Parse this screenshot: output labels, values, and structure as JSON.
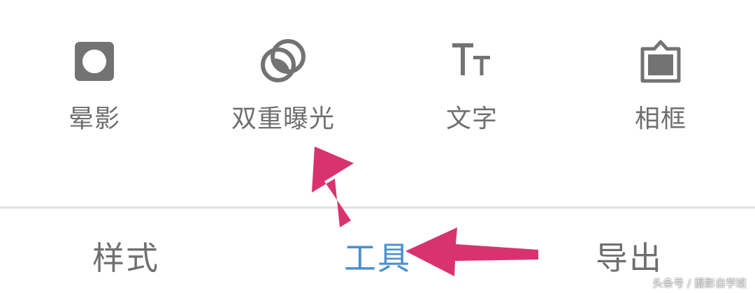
{
  "tools": [
    {
      "label": "晕影",
      "icon": "vignette-icon"
    },
    {
      "label": "双重曝光",
      "icon": "double-exposure-icon"
    },
    {
      "label": "文字",
      "icon": "text-icon"
    },
    {
      "label": "相框",
      "icon": "frame-icon"
    }
  ],
  "tabs": [
    {
      "label": "样式",
      "active": false
    },
    {
      "label": "工具",
      "active": true
    },
    {
      "label": "导出",
      "active": false
    }
  ],
  "annotation_arrow_color": "#d8336f",
  "active_tab_color": "#4a8fd0",
  "watermark": "头条号 / 摄影自学班"
}
